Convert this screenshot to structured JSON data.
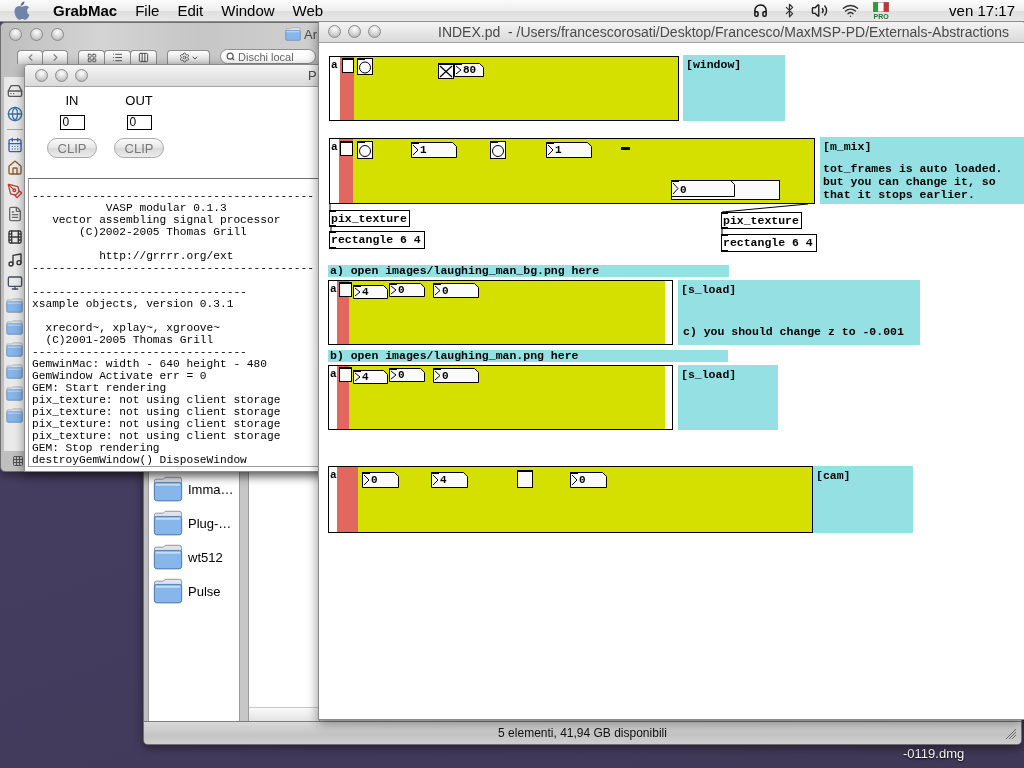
{
  "menubar": {
    "app_name": "GrabMac",
    "menus": [
      "File",
      "Edit",
      "Window",
      "Web"
    ],
    "input_menu_label": "PRO",
    "clock": "ven 17:17"
  },
  "finder_window": {
    "title": "Ar",
    "search": {
      "placeholder": "Dischi local"
    }
  },
  "pd_window": {
    "title": "P",
    "meters": [
      {
        "label": "IN",
        "value": "0",
        "button": "CLIP"
      },
      {
        "label": "OUT",
        "value": "0",
        "button": "CLIP"
      }
    ],
    "console": {
      "blocks": [
        [
          "------------------------------------------",
          "           VASP modular 0.1.3",
          "   vector assembling signal processor",
          "       (C)2002-2005 Thomas Grill"
        ],
        [
          "          http://grrrr.org/ext",
          "------------------------------------------"
        ],
        [
          "--------------------------------",
          "xsample objects, version 0.3.1"
        ],
        [
          "  xrecord~, xplay~, xgroove~",
          "  (C)2001-2005 Thomas Grill",
          "--------------------------------",
          "GemwinMac: width - 640 height - 480",
          "GemWindow Activate err = 0",
          "GEM: Start rendering",
          "pix_texture: not using client storage",
          "pix_texture: not using client storage",
          "pix_texture: not using client storage",
          "pix_texture: not using client storage",
          "GEM: Stop rendering",
          "destroyGemWindow() DisposeWindow"
        ]
      ]
    }
  },
  "patch_window": {
    "title": "INDEX.pd  - /Users/francescorosati/Desktop/Francesco/MaxMSP-PD/Externals-Abstractions",
    "objects": [
      {
        "kind": "gop",
        "label": "a",
        "widgets": [
          {
            "kind": "toggle",
            "checked": false
          },
          {
            "kind": "bang"
          },
          {
            "kind": "toggle",
            "checked": true
          },
          {
            "kind": "number",
            "value": "80"
          }
        ]
      },
      {
        "kind": "comment",
        "title": "[window]"
      },
      {
        "kind": "gop",
        "label": "a",
        "widgets": [
          {
            "kind": "toggle",
            "checked": false
          },
          {
            "kind": "bang"
          },
          {
            "kind": "number",
            "value": "1"
          },
          {
            "kind": "bang"
          },
          {
            "kind": "number",
            "value": "1"
          },
          {
            "kind": "dash"
          },
          {
            "kind": "number_wide",
            "value": "0"
          }
        ]
      },
      {
        "kind": "comment",
        "title": "[m_mix]",
        "body": [
          "tot_frames is auto loaded.",
          "but you can change it, so",
          "that it stops earlier."
        ]
      },
      {
        "kind": "object",
        "text": "pix_texture"
      },
      {
        "kind": "object",
        "text": "pix_texture"
      },
      {
        "kind": "object",
        "text": "rectangle 6 4"
      },
      {
        "kind": "object",
        "text": "rectangle 6 4"
      },
      {
        "kind": "label",
        "text": "a) open images/laughing_man_bg.png here"
      },
      {
        "kind": "gop",
        "label": "a",
        "widgets": [
          {
            "kind": "toggle",
            "checked": false
          },
          {
            "kind": "number",
            "value": "4"
          },
          {
            "kind": "number",
            "value": "0"
          },
          {
            "kind": "number",
            "value": "0"
          }
        ]
      },
      {
        "kind": "comment",
        "title": "[s_load]",
        "note": "c) you should change z to -0.001"
      },
      {
        "kind": "label",
        "text": "b) open images/laughing_man.png here"
      },
      {
        "kind": "gop",
        "label": "a",
        "widgets": [
          {
            "kind": "toggle",
            "checked": false
          },
          {
            "kind": "number",
            "value": "4"
          },
          {
            "kind": "number",
            "value": "0"
          },
          {
            "kind": "number",
            "value": "0"
          }
        ]
      },
      {
        "kind": "comment",
        "title": "[s_load]"
      },
      {
        "kind": "gop",
        "label": "a",
        "widgets": [
          {
            "kind": "number",
            "value": "0"
          },
          {
            "kind": "number",
            "value": "4"
          },
          {
            "kind": "toggle",
            "checked": false
          },
          {
            "kind": "number",
            "value": "0"
          }
        ]
      },
      {
        "kind": "comment",
        "title": "[cam]"
      }
    ]
  },
  "finder_browser": {
    "sidebar": {
      "items": [
        {
          "label": "Imma…"
        },
        {
          "label": "Plug-…"
        },
        {
          "label": "wt512"
        },
        {
          "label": "Pulse"
        }
      ]
    },
    "status_bar": "5 elementi, 41,94 GB disponibili"
  },
  "desktop": {
    "icons": [
      {
        "label": "-0119.dmg"
      }
    ]
  }
}
